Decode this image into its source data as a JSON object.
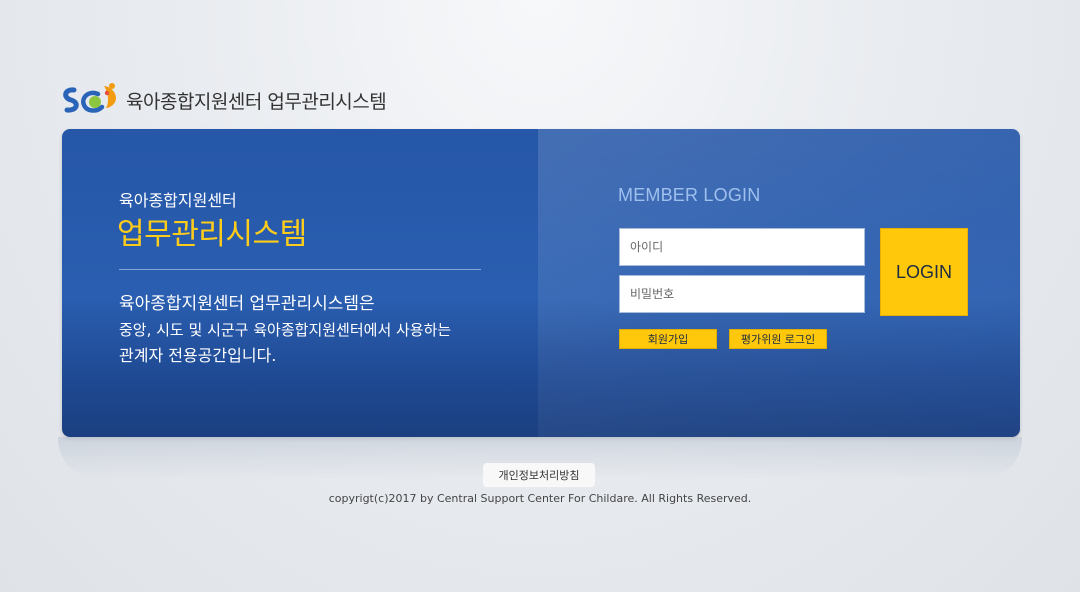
{
  "header": {
    "title": "육아종합지원센터 업무관리시스템",
    "logo_icon": "sc-logo-icon"
  },
  "left": {
    "subtitle": "육아종합지원센터",
    "main_title": "업무관리시스템",
    "desc_line1": "육아종합지원센터 업무관리시스템은",
    "desc_line2": "중앙, 시도 및 시군구 육아종합지원센터에서 사용하는",
    "desc_line3": "관계자 전용공간입니다."
  },
  "login": {
    "title": "MEMBER LOGIN",
    "id_placeholder": "아이디",
    "pw_placeholder": "비밀번호",
    "login_label": "LOGIN",
    "signup_label": "회원가입",
    "eval_login_label": "평가위원 로그인"
  },
  "footer": {
    "privacy_label": "개인정보처리방침",
    "copyright": "copyrigt(c)2017 by Central Support Center For Childare. All Rights Reserved."
  },
  "colors": {
    "panel_blue": "#2657a8",
    "accent_yellow": "#ffc80a",
    "title_yellow": "#ffcc1a"
  }
}
